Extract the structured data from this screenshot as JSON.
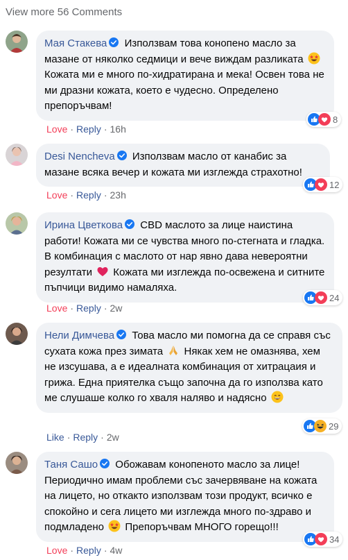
{
  "view_more": "View more 56 Comments",
  "comments": [
    {
      "author": "Мая Стакева",
      "text1": "Използвам това конопено масло за мазане от няколко седмици и вече виждам разликата",
      "text2": "Кожата ми е много по-хидратирана и мека! Освен това не ми дразни кожата, което е чудесно. Определено препоръчвам!",
      "action": "Love",
      "reply": "Reply",
      "time": "16h",
      "count": "8"
    },
    {
      "author": "Desi Nencheva",
      "text1": "Използвам масло от канабис за мазане всяка вечер и кожата ми изглежда страхотно!",
      "action": "Love",
      "reply": "Reply",
      "time": "23h",
      "count": "12"
    },
    {
      "author": "Ирина Цветкова",
      "text1": "CBD маслото за лице наистина работи! Кожата ми се чувства много по-стегната и гладка. В комбинация с маслото от нар явно дава невероятни резултати",
      "text2": "Кожата ми изглежда по-освежена и ситните пъпчици видимо намаляха.",
      "action": "Love",
      "reply": "Reply",
      "time": "2w",
      "count": "24"
    },
    {
      "author": "Нели Димчева",
      "text1": "Това масло ми помогна да се справя със сухата кожа през зимата",
      "text2": "Някак хем не омазнява, хем не изсушава, а е идеалната комбинация от хитрацаия и грижа. Една приятелка също започна да го използва като ме слушаше колко го хваля наляво и надясно",
      "action": "Like",
      "reply": "Reply",
      "time": "2w",
      "count": "29"
    },
    {
      "author": "Таня Сашо",
      "text1": "Обожавам конопеното масло за лице! Периодично имам проблеми със зачервяване на кожата на лицето, но откакто използвам този продукт, всичко е спокойно и сега лицето ми изглежда много по-здраво и подмладено",
      "text2": "Препоръчвам МНОГО горещо!!!",
      "action": "Love",
      "reply": "Reply",
      "time": "4w",
      "count": "34"
    }
  ],
  "colors": {
    "link": "#385898",
    "love": "#f33e58",
    "bubble": "#f0f2f5",
    "meta": "#65676b"
  }
}
